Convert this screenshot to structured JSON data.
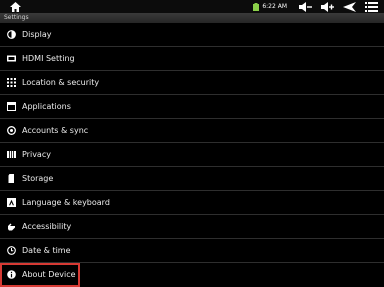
{
  "status_bar": {
    "time": "6:22 AM",
    "icons": [
      "home-icon",
      "battery-icon",
      "volume-down-icon",
      "volume-up-icon",
      "back-icon",
      "menu-icon"
    ]
  },
  "header": {
    "title": "Settings"
  },
  "settings": {
    "items": [
      {
        "label": "Display",
        "icon": "display-icon"
      },
      {
        "label": "HDMI Setting",
        "icon": "hdmi-icon"
      },
      {
        "label": "Location & security",
        "icon": "location-icon"
      },
      {
        "label": "Applications",
        "icon": "applications-icon"
      },
      {
        "label": "Accounts & sync",
        "icon": "accounts-sync-icon"
      },
      {
        "label": "Privacy",
        "icon": "privacy-icon"
      },
      {
        "label": "Storage",
        "icon": "storage-icon"
      },
      {
        "label": "Language & keyboard",
        "icon": "keyboard-icon"
      },
      {
        "label": "Accessibility",
        "icon": "accessibility-icon"
      },
      {
        "label": "Date & time",
        "icon": "clock-icon"
      },
      {
        "label": "About Device",
        "icon": "info-icon"
      }
    ]
  },
  "colors": {
    "highlight": "#d63a34",
    "battery": "#8bd04a"
  }
}
